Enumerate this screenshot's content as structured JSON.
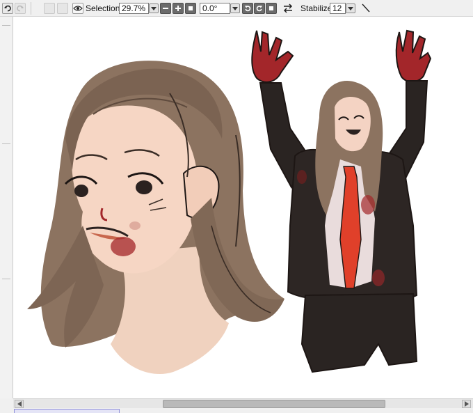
{
  "toolbar": {
    "undo_icon": "undo-icon",
    "redo_icon": "redo-icon",
    "selection_label": "Selection",
    "zoom_value": "29.7%",
    "rotation_value": "0.0°",
    "stabilizer_label": "Stabilizer",
    "stabilizer_value": "12"
  },
  "colors": {
    "hair": "#8c7360",
    "hair_dark": "#5e4a3d",
    "skin": "#f3d3c0",
    "blood": "#a3262a",
    "tie": "#e0402a",
    "suit": "#2a2422",
    "shirt": "#e9dcdc",
    "line": "#1d1614"
  }
}
